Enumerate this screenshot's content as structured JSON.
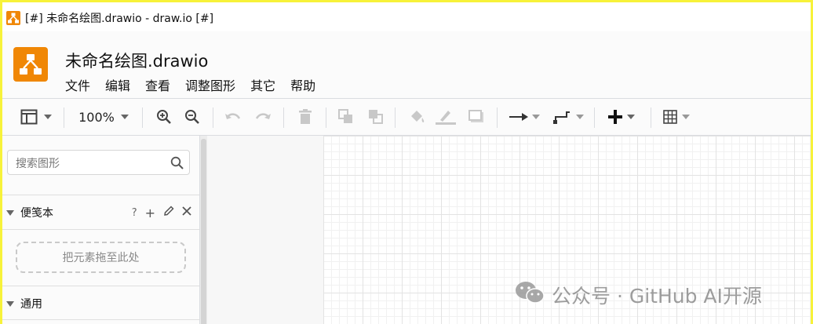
{
  "window": {
    "title": "[#] 未命名绘图.drawio - draw.io [#]"
  },
  "header": {
    "doc_title": "未命名绘图.drawio",
    "menu": [
      "文件",
      "编辑",
      "查看",
      "调整图形",
      "其它",
      "帮助"
    ]
  },
  "toolbar": {
    "zoom": "100%",
    "icons": [
      "format-panel-icon",
      "zoom-in-icon",
      "zoom-out-icon",
      "undo-icon",
      "redo-icon",
      "delete-icon",
      "to-front-icon",
      "to-back-icon",
      "fill-color-icon",
      "line-color-icon",
      "shadow-icon",
      "connection-icon",
      "waypoints-icon",
      "insert-icon",
      "table-icon"
    ]
  },
  "sidebar": {
    "search_placeholder": "搜索图形",
    "scratchpad_label": "便笺本",
    "scratchpad_actions": [
      "?",
      "+"
    ],
    "dropzone_text": "把元素拖至此处",
    "general_label": "通用"
  },
  "watermark": {
    "text": "公众号 · GitHub AI开源"
  },
  "colors": {
    "brand": "#f08705",
    "window_border": "#f7f23a"
  }
}
